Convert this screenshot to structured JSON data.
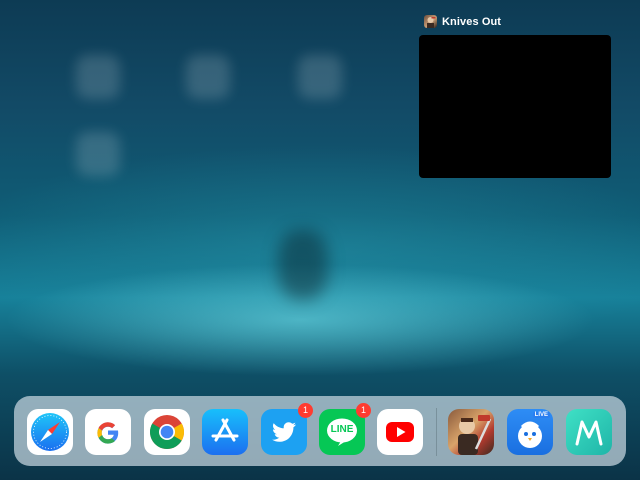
{
  "pip": {
    "title": "Knives Out",
    "app_icon": "knives-out-game-icon"
  },
  "dock": {
    "apps": [
      {
        "name": "Safari",
        "icon": "safari-compass-icon"
      },
      {
        "name": "Google",
        "icon": "google-g-icon"
      },
      {
        "name": "Chrome",
        "icon": "chrome-icon"
      },
      {
        "name": "App Store",
        "icon": "app-store-a-icon"
      },
      {
        "name": "Twitter",
        "icon": "twitter-bird-icon",
        "badge": "1"
      },
      {
        "name": "LINE",
        "icon": "line-chat-icon",
        "label": "LINE",
        "badge": "1"
      },
      {
        "name": "YouTube",
        "icon": "youtube-play-icon"
      }
    ],
    "recent_apps": [
      {
        "name": "Knives Out",
        "icon": "knives-out-game-icon"
      },
      {
        "name": "Live streaming app",
        "icon": "bird-live-icon",
        "label": "LIVE"
      },
      {
        "name": "M app",
        "icon": "m-letter-icon",
        "label": "M"
      }
    ]
  },
  "colors": {
    "badge": "#ff3b30",
    "twitter": "#1da1f2",
    "line": "#06c755",
    "youtube": "#ff0000",
    "app_store": "#1c8cf0"
  }
}
